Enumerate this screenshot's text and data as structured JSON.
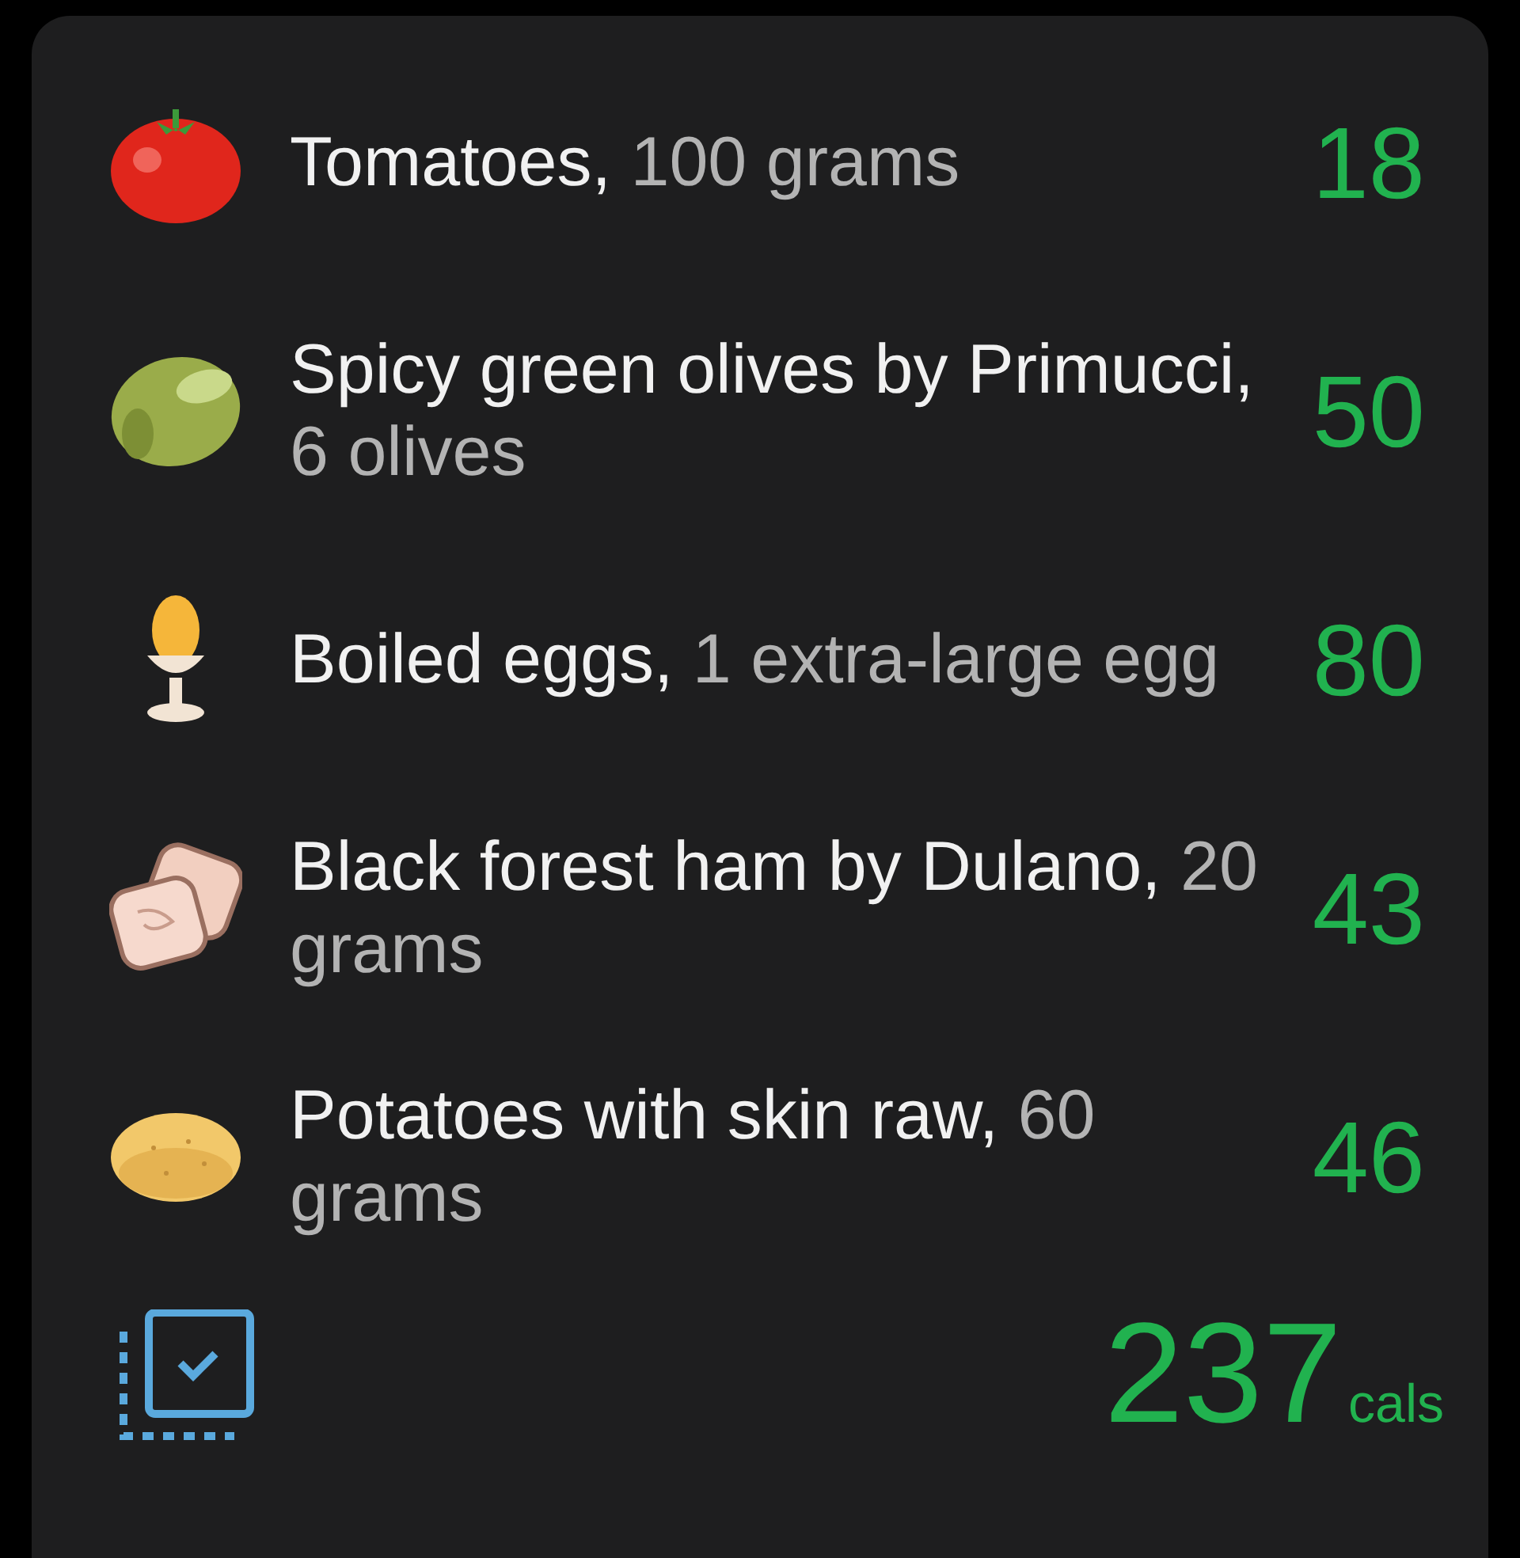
{
  "foods": [
    {
      "kind": "tomato",
      "name": "Tomatoes,",
      "amount": "100 grams",
      "calories": "18"
    },
    {
      "kind": "olive",
      "name": "Spicy green olives by Primucci,",
      "amount": "6 olives",
      "calories": "50"
    },
    {
      "kind": "egg",
      "name": "Boiled eggs,",
      "amount": "1 extra-large egg",
      "calories": "80"
    },
    {
      "kind": "ham",
      "name": "Black forest ham by Dulano,",
      "amount": "20 grams",
      "calories": "43"
    },
    {
      "kind": "potato",
      "name": "Potatoes with skin raw,",
      "amount": "60 grams",
      "calories": "46"
    }
  ],
  "total": {
    "value": "237",
    "unit": "cals"
  }
}
